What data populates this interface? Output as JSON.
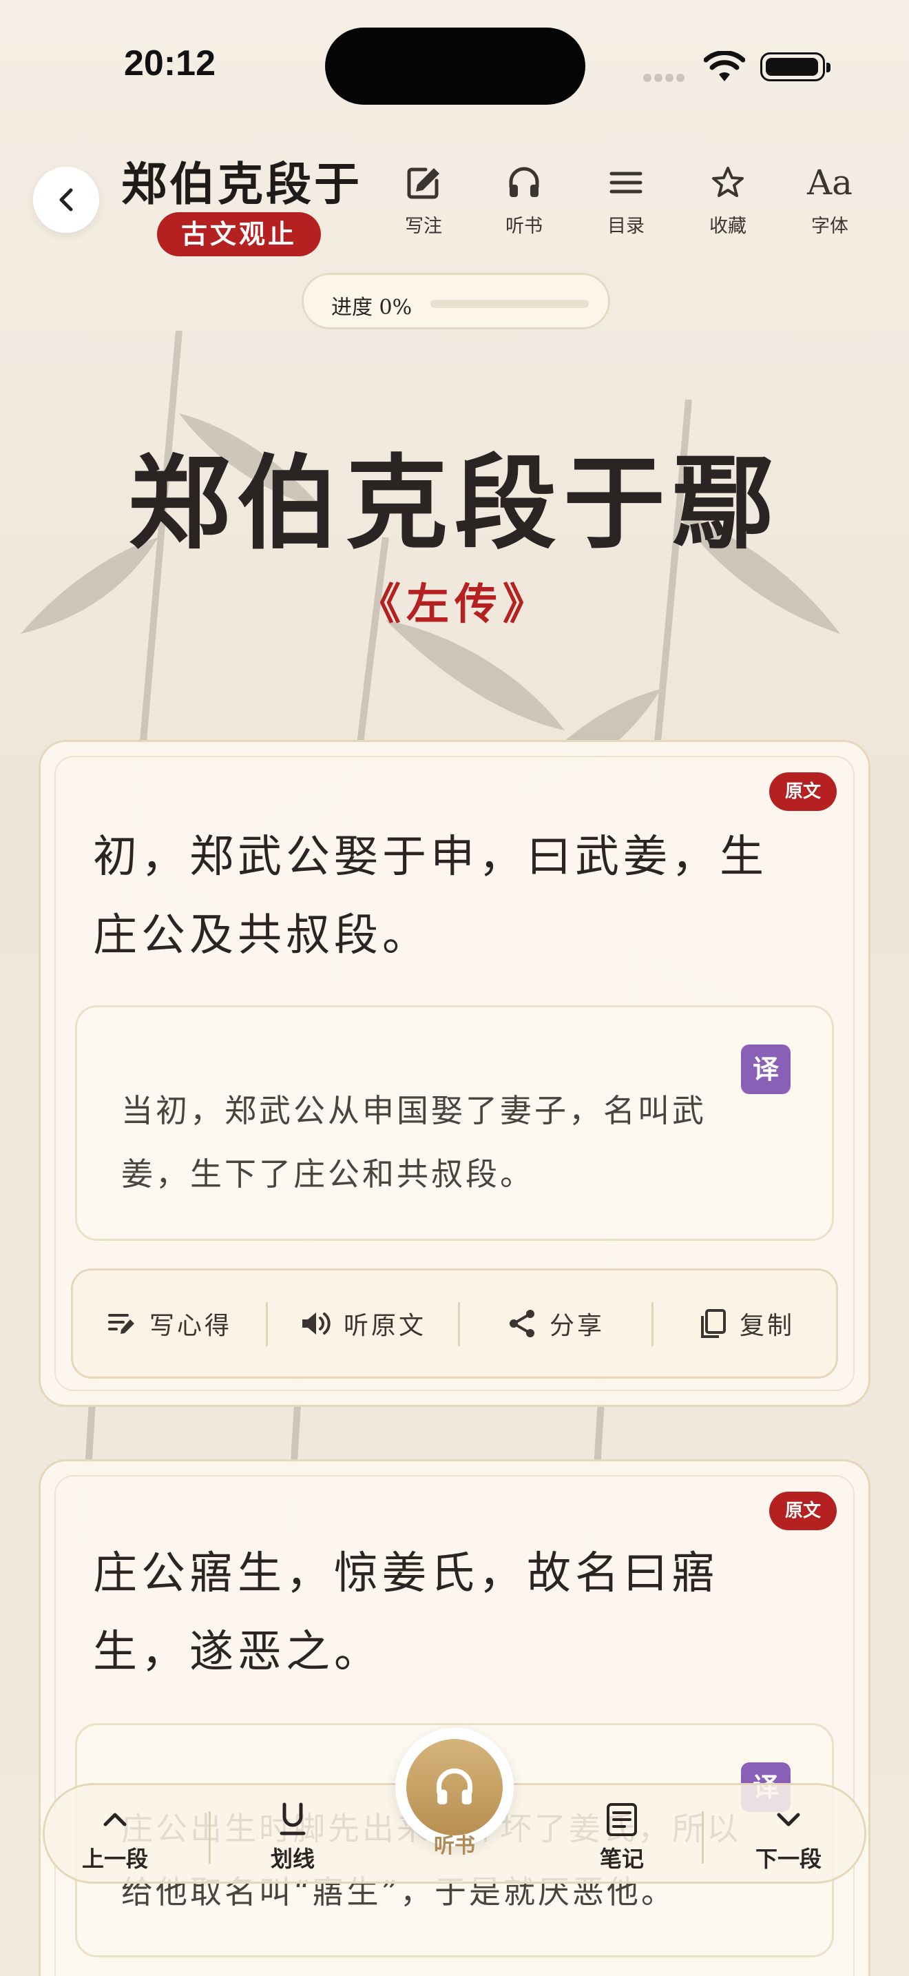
{
  "status_bar": {
    "time": "20:12"
  },
  "header": {
    "title": "郑伯克段于",
    "book": "古文观止",
    "tools": [
      {
        "label": "写注",
        "icon": "edit-icon"
      },
      {
        "label": "听书",
        "icon": "headphones-icon"
      },
      {
        "label": "目录",
        "icon": "menu-icon"
      },
      {
        "label": "收藏",
        "icon": "star-icon"
      },
      {
        "label": "字体",
        "icon": "font-icon",
        "glyph": "Aa"
      }
    ],
    "progress": {
      "label": "进度 0%",
      "percent": 0
    }
  },
  "article": {
    "title": "郑伯克段于鄢",
    "source": "《左传》"
  },
  "paragraphs": [
    {
      "badge": "原文",
      "original": "初，郑武公娶于申，曰武姜，生庄公及共叔段。",
      "translation_badge": "译",
      "translation": "当初，郑武公从申国娶了妻子，名叫武姜，生下了庄公和共叔段。"
    },
    {
      "badge": "原文",
      "original": "庄公寤生，惊姜氏，故名曰寤生，遂恶之。",
      "translation_badge": "译",
      "translation": "庄公出生时脚先出来，吓坏了姜氏，所以给他取名叫“寤生”，于是就厌恶他。"
    }
  ],
  "actions": [
    {
      "label": "写心得",
      "icon": "write-note-icon"
    },
    {
      "label": "听原文",
      "icon": "speaker-icon"
    },
    {
      "label": "分享",
      "icon": "share-icon"
    },
    {
      "label": "复制",
      "icon": "copy-icon"
    }
  ],
  "bottom_nav": {
    "prev": "上一段",
    "underline": "划线",
    "listen": "听书",
    "notes": "笔记",
    "next": "下一段"
  },
  "colors": {
    "accent_red": "#b52020",
    "translation_badge": "#8a5fb6",
    "gold": "#c9a66b"
  }
}
